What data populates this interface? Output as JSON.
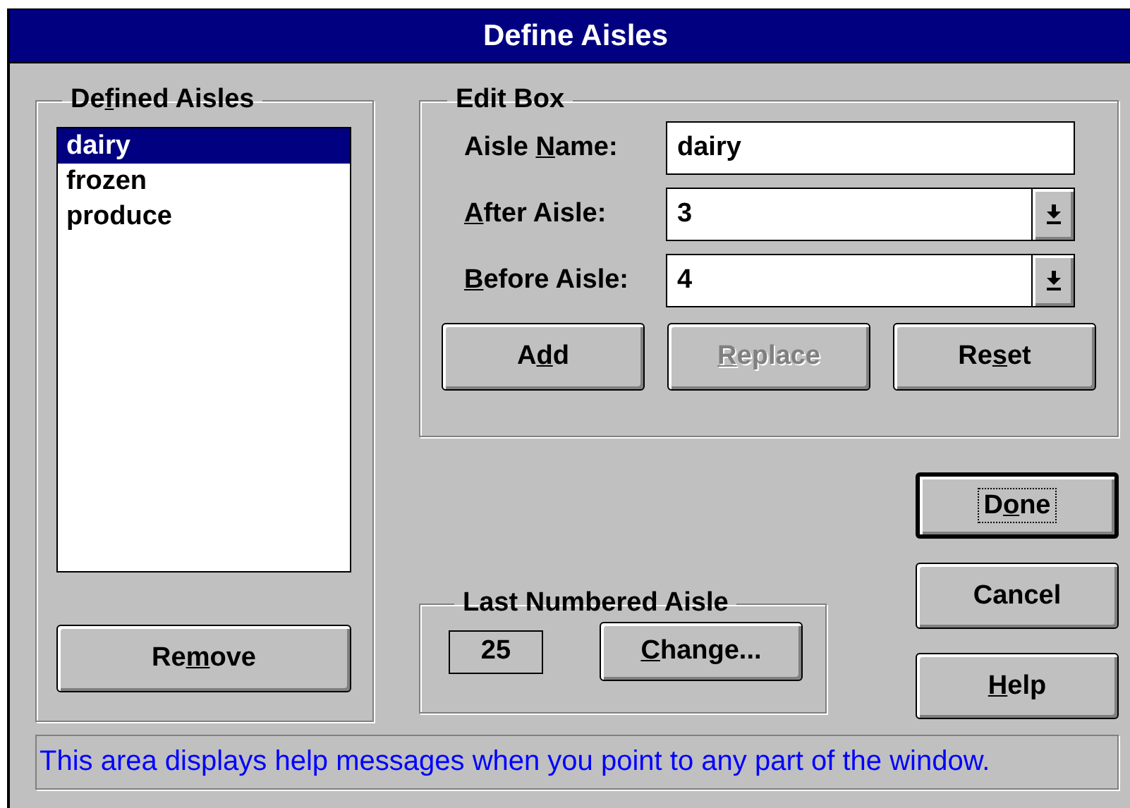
{
  "window": {
    "title": "Define Aisles"
  },
  "defined_aisles": {
    "label": {
      "before": "De",
      "key": "f",
      "after": "ined Aisles"
    },
    "items": [
      {
        "label": "dairy",
        "selected": true
      },
      {
        "label": "frozen",
        "selected": false
      },
      {
        "label": "produce",
        "selected": false
      }
    ],
    "remove_button": {
      "label": {
        "before": "Re",
        "key": "m",
        "after": "ove"
      }
    }
  },
  "edit_box": {
    "label": {
      "before": "Edit Box"
    },
    "fields": [
      {
        "kind": "text",
        "label": {
          "before": "Aisle ",
          "key": "N",
          "after": "ame:"
        },
        "value": "dairy"
      },
      {
        "kind": "dropdown",
        "label": {
          "key": "A",
          "after": "fter Aisle:"
        },
        "value": "3"
      },
      {
        "kind": "dropdown",
        "label": {
          "key": "B",
          "after": "efore Aisle:"
        },
        "value": "4"
      }
    ],
    "buttons": [
      {
        "label": {
          "before": "A",
          "key": "d",
          "after": "d"
        },
        "disabled": false
      },
      {
        "label": {
          "key": "R",
          "after": "eplace"
        },
        "disabled": true
      },
      {
        "label": {
          "before": "Re",
          "key": "s",
          "after": "et"
        },
        "disabled": false
      }
    ]
  },
  "last_numbered_aisle": {
    "label": {
      "before": "Last Numbered Aisle"
    },
    "value": "25",
    "button": {
      "label": {
        "key": "C",
        "after": "hange..."
      }
    }
  },
  "dialog_buttons": [
    {
      "label": {
        "before": "D",
        "key": "o",
        "after": "ne"
      },
      "default": true
    },
    {
      "label": {
        "before": "Cancel"
      },
      "default": false
    },
    {
      "label": {
        "key": "H",
        "after": "elp"
      },
      "default": false
    }
  ],
  "status_bar": {
    "text": "This area displays help messages when you point to any part of the window."
  }
}
